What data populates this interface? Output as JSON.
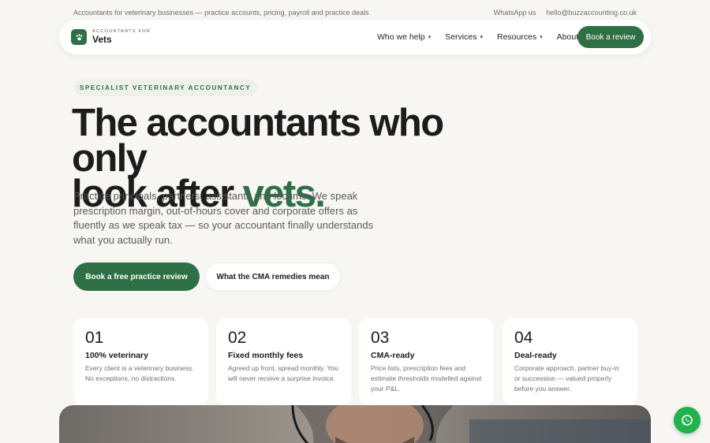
{
  "topbar": {
    "tagline": "Accountants for veterinary businesses — practice accounts, pricing, payroll and practice deals",
    "whatsapp_link": "WhatsApp us",
    "email_link": "hello@buzzaccounting.co.uk"
  },
  "nav": {
    "logo_small": "ACCOUNTANTS FOR",
    "logo_big": "Vets",
    "logo_icon": "paw-icon",
    "items": [
      {
        "label": "Who we help",
        "has_dropdown": true
      },
      {
        "label": "Services",
        "has_dropdown": true
      },
      {
        "label": "Resources",
        "has_dropdown": true
      },
      {
        "label": "About",
        "has_dropdown": false
      }
    ],
    "cta": "Book a review"
  },
  "hero": {
    "eyebrow": "SPECIALIST VETERINARY ACCOUNTANCY",
    "headline_line1": "The accountants who only",
    "headline_line2_start": "look after ",
    "headline_accent": "vets.",
    "lede": "Practice principals, partners, assistants and locums. We speak prescription margin, out-of-hours cover and corporate offers as fluently as we speak tax — so your accountant finally understands what you actually run.",
    "primary_cta": "Book a free practice review",
    "secondary_cta": "What the CMA remedies mean"
  },
  "features": [
    {
      "num": "01",
      "title": "100% veterinary",
      "desc": "Every client is a veterinary business. No exceptions, no distractions."
    },
    {
      "num": "02",
      "title": "Fixed monthly fees",
      "desc": "Agreed up front, spread monthly. You will never receive a surprise invoice."
    },
    {
      "num": "03",
      "title": "CMA-ready",
      "desc": "Price lists, prescription fees and estimate thresholds modelled against your P&L."
    },
    {
      "num": "04",
      "title": "Deal-ready",
      "desc": "Corporate approach, partner buy-in or succession — valued properly before you answer."
    }
  ],
  "floating": {
    "icon": "whatsapp-icon"
  },
  "colors": {
    "brand_green": "#2e6f45",
    "page_bg": "#f7f6f3",
    "whatsapp_green": "#22b24c"
  }
}
